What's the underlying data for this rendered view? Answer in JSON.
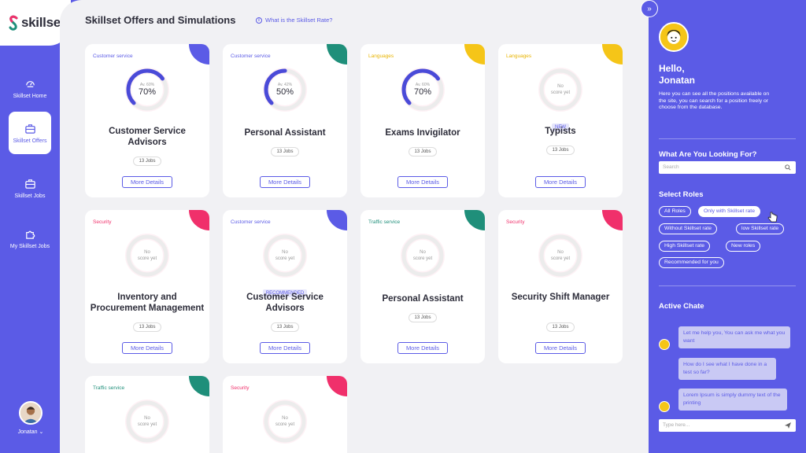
{
  "app": {
    "name": "skillset"
  },
  "nav": {
    "items": [
      {
        "label": "Skillset Home",
        "icon": "home-icon"
      },
      {
        "label": "Skillset Offers",
        "icon": "briefcase-icon",
        "active": true
      },
      {
        "label": "Skillset Jobs",
        "icon": "briefcase-icon"
      },
      {
        "label": "My Skillset Jobs",
        "icon": "puzzle-icon"
      }
    ],
    "user": "Jonatan ⌄"
  },
  "header": {
    "title": "Skillset Offers and Simulations",
    "rate_link": "What is the Skillset Rate?"
  },
  "colors": {
    "primary": "#5b5be6",
    "green": "#1f8f7a",
    "yellow": "#f5c518",
    "red": "#f0306b"
  },
  "cards": [
    {
      "category": "Customer service",
      "cat_color": "#5b5be6",
      "corner": "#5b5be6",
      "title": "Customer Service Advisors",
      "jobs": "13 Jobs",
      "score": 70,
      "avg": "Av. 60%",
      "pct": "70%",
      "badge": "",
      "button": "More Details"
    },
    {
      "category": "Customer service",
      "cat_color": "#5b5be6",
      "corner": "#1f8f7a",
      "title": "Personal Assistant",
      "jobs": "13 Jobs",
      "score": 50,
      "avg": "Av. 42%",
      "pct": "50%",
      "badge": "",
      "button": "More Details"
    },
    {
      "category": "Languages",
      "cat_color": "#e8b400",
      "corner": "#f5c518",
      "title": "Exams Invigilator",
      "jobs": "13 Jobs",
      "score": 70,
      "avg": "Av. 60%",
      "pct": "70%",
      "badge": "",
      "button": "More Details"
    },
    {
      "category": "Languages",
      "cat_color": "#e8b400",
      "corner": "#f5c518",
      "title": "Typists",
      "jobs": "13 Jobs",
      "score": null,
      "noscore": "No score yet",
      "badge": "NEW",
      "button": "More Details"
    },
    {
      "category": "Security",
      "cat_color": "#f0306b",
      "corner": "#f0306b",
      "title": "Inventory and Procurement Management",
      "jobs": "13 Jobs",
      "score": null,
      "noscore": "No score yet",
      "badge": "",
      "button": "More Details"
    },
    {
      "category": "Customer service",
      "cat_color": "#5b5be6",
      "corner": "#5b5be6",
      "title": "Customer Service Advisors",
      "jobs": "13 Jobs",
      "score": null,
      "noscore": "No score yet",
      "badge": "RECOMMENDED",
      "button": "More Details"
    },
    {
      "category": "Traffic service",
      "cat_color": "#1f8f7a",
      "corner": "#1f8f7a",
      "title": "Personal Assistant",
      "jobs": "13 Jobs",
      "score": null,
      "noscore": "No score yet",
      "badge": "",
      "button": "More Details"
    },
    {
      "category": "Security",
      "cat_color": "#f0306b",
      "corner": "#f0306b",
      "title": "Security Shift Manager",
      "jobs": "13 Jobs",
      "score": null,
      "noscore": "No score yet",
      "badge": "",
      "button": "More Details"
    },
    {
      "category": "Traffic service",
      "cat_color": "#1f8f7a",
      "corner": "#1f8f7a",
      "title": "",
      "jobs": "",
      "score": null,
      "noscore": "No score yet",
      "badge": "",
      "button": ""
    },
    {
      "category": "Security",
      "cat_color": "#f0306b",
      "corner": "#f0306b",
      "title": "",
      "jobs": "",
      "score": null,
      "noscore": "No score yet",
      "badge": "",
      "button": ""
    }
  ],
  "panel": {
    "greeting_1": "Hello,",
    "greeting_2": "Jonatan",
    "intro": "Here you can see all the positions available on the site, you can search for a position freely or choose from the database.",
    "looking_title": "What Are You Looking For?",
    "search_placeholder": "Search",
    "roles_title": "Select Roles",
    "roles": [
      {
        "label": "All Roles",
        "on": false
      },
      {
        "label": "Only with Skillset rate",
        "on": true
      },
      {
        "label": "Without Skillset rate",
        "on": false
      },
      {
        "label": "low Skillset rate",
        "on": false
      },
      {
        "label": "High Skillset rate",
        "on": false
      },
      {
        "label": "New roles",
        "on": false
      },
      {
        "label": "Recommended for you",
        "on": false
      }
    ],
    "chat_title": "Active Chate",
    "messages": [
      {
        "text": "Let me help you, You can ask me what you want",
        "from": "bot"
      },
      {
        "text": "How do I see what I have done in a test so far?",
        "from": "user"
      },
      {
        "text": "Lorem Ipsum is simply dummy text of the printing",
        "from": "bot"
      }
    ],
    "chat_placeholder": "Type here..."
  }
}
